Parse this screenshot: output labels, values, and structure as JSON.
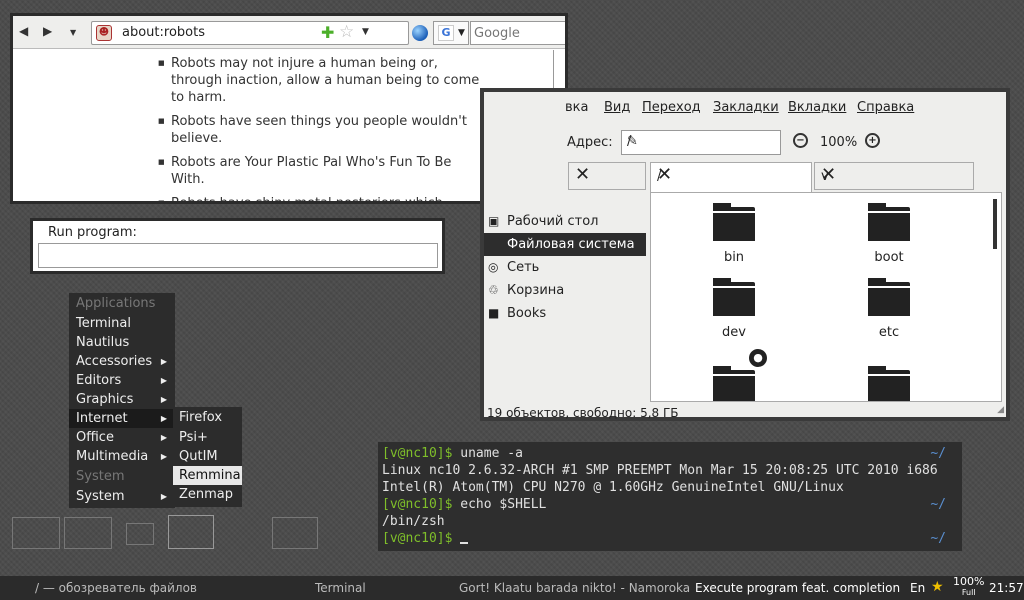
{
  "browser": {
    "url": "about:robots",
    "search_placeholder": "Google",
    "engine_icon": "G",
    "robots": [
      "Robots may not injure a human being or, through inaction, allow a human being to come to harm.",
      "Robots have seen things you people wouldn't believe.",
      "Robots are Your Plastic Pal Who's Fun To Be With.",
      "Robots have shiny metal posteriors which should not be bitten."
    ]
  },
  "run_program": {
    "label": "Run program:",
    "value": ""
  },
  "file_manager": {
    "menu": [
      "вка",
      "Вид",
      "Переход",
      "Закладки",
      "Вкладки",
      "Справка"
    ],
    "address_label": "Адрес:",
    "address_value": "/",
    "zoom": "100%",
    "tabs": [
      "",
      "/",
      "v"
    ],
    "sidebar": [
      "Рабочий стол",
      "Файловая система",
      "Сеть",
      "Корзина",
      "Books"
    ],
    "folders": [
      "bin",
      "boot",
      "dev",
      "etc",
      "",
      ""
    ],
    "status": "19 объектов, свободно: 5,8 ГБ"
  },
  "menu": {
    "items": [
      "Applications",
      "Terminal",
      "Nautilus",
      "Accessories",
      "Editors",
      "Graphics",
      "Internet",
      "Office",
      "Multimedia",
      "System",
      "System"
    ],
    "submenu": [
      "Firefox",
      "Psi+",
      "QutIM",
      "Remmina",
      "Zenmap"
    ]
  },
  "terminal": {
    "prompt": "[v@nc10]$",
    "path": "~/",
    "cmd1": " uname -a",
    "out1": "Linux nc10 2.6.32-ARCH #1 SMP PREEMPT Mon Mar 15 20:08:25 UTC 2010 i686",
    "out2": "Intel(R) Atom(TM) CPU N270 @ 1.60GHz GenuineIntel GNU/Linux",
    "cmd2": " echo $SHELL",
    "out3": "/bin/zsh"
  },
  "taskbar": {
    "tasks": [
      "/ — обозреватель файлов",
      "Terminal",
      "Gort! Klaatu barada nikto! - Namoroka",
      "Execute program feat. completion"
    ],
    "layout": "En",
    "battery_pct": "100%",
    "battery_state": "Full",
    "clock": "21:57"
  },
  "colors": {
    "prompt": "#7fbf2a",
    "path": "#5a8fd0",
    "panel": "#2b2b2b"
  }
}
